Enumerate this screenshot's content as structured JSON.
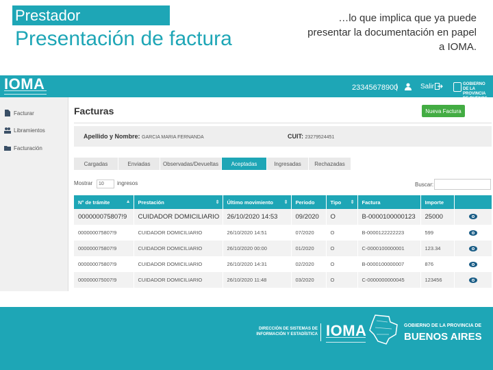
{
  "slide": {
    "tag": "Prestador",
    "title": "Presentación de factura",
    "note": "…lo que implica que ya puede presentar la documentación en papel a IOMA."
  },
  "topbar": {
    "logo": "IOMA",
    "user_id": "23345678900",
    "logout_label": "Salir",
    "brand_text": "GOBIERNO DE LA PROVINCIA DE BUENOS AIRES"
  },
  "sidebar": {
    "items": [
      {
        "label": "Facturar",
        "icon": "document-icon"
      },
      {
        "label": "Libramientos",
        "icon": "people-icon"
      },
      {
        "label": "Facturación",
        "icon": "folder-icon"
      }
    ]
  },
  "main": {
    "title": "Facturas",
    "new_button": "Nueva Factura",
    "name_label": "Apellido y Nombre:",
    "name_value": "GARCIA MARIA FERNANDA",
    "cuit_label": "CUIT:",
    "cuit_value": "23279524451",
    "tabs": [
      {
        "label": "Cargadas",
        "active": false
      },
      {
        "label": "Enviadas",
        "active": false
      },
      {
        "label": "Observadas/Devueltas",
        "active": false
      },
      {
        "label": "Aceptadas",
        "active": true
      },
      {
        "label": "Ingresadas",
        "active": false
      },
      {
        "label": "Rechazadas",
        "active": false
      }
    ],
    "show_label": "Mostrar",
    "page_length": "10",
    "entries_label": "ingresos",
    "search_label": "Buscar:",
    "search_value": "",
    "table": {
      "headers": [
        "N° de trámite",
        "Prestación",
        "Último movimiento",
        "Periodo",
        "Tipo",
        "Factura",
        "Importe"
      ],
      "rows": [
        [
          "000000075807!9",
          "CUIDADOR DOMICILIARIO",
          "26/10/2020 14:53",
          "09/2020",
          "O",
          "B-0000100000123",
          "25000"
        ],
        [
          "000000075807!9",
          "CUIDADOR DOMICILIARIO",
          "26/10/2020 14:51",
          "07/2020",
          "O",
          "B-0000122222223",
          "599"
        ],
        [
          "000000075807!9",
          "CUIDADOR DOMICILIARIO",
          "26/10/2020 00:00",
          "01/2020",
          "O",
          "C-0000100000001",
          "123.34"
        ],
        [
          "000000075807!9",
          "CUIDADOR DOMICILIARIO",
          "26/10/2020 14:31",
          "02/2020",
          "O",
          "B-0000100000007",
          "876"
        ],
        [
          "000000075007!9",
          "CUIDADOR DOMICILIARIO",
          "26/10/2020 11:48",
          "03/2020",
          "O",
          "C-0000000000045",
          "123456"
        ]
      ]
    }
  },
  "footer": {
    "direction": "DIRECCIÓN DE SISTEMAS DE INFORMACIÓN Y ESTADÍSTICA",
    "logo": "IOMA",
    "gobierno": "GOBIERNO DE LA PROVINCIA DE",
    "buenos_aires": "BUENOS AIRES"
  },
  "colors": {
    "accent": "#1ea6b6",
    "new_button": "#43ac43",
    "eye_icon": "#1a5d86"
  }
}
